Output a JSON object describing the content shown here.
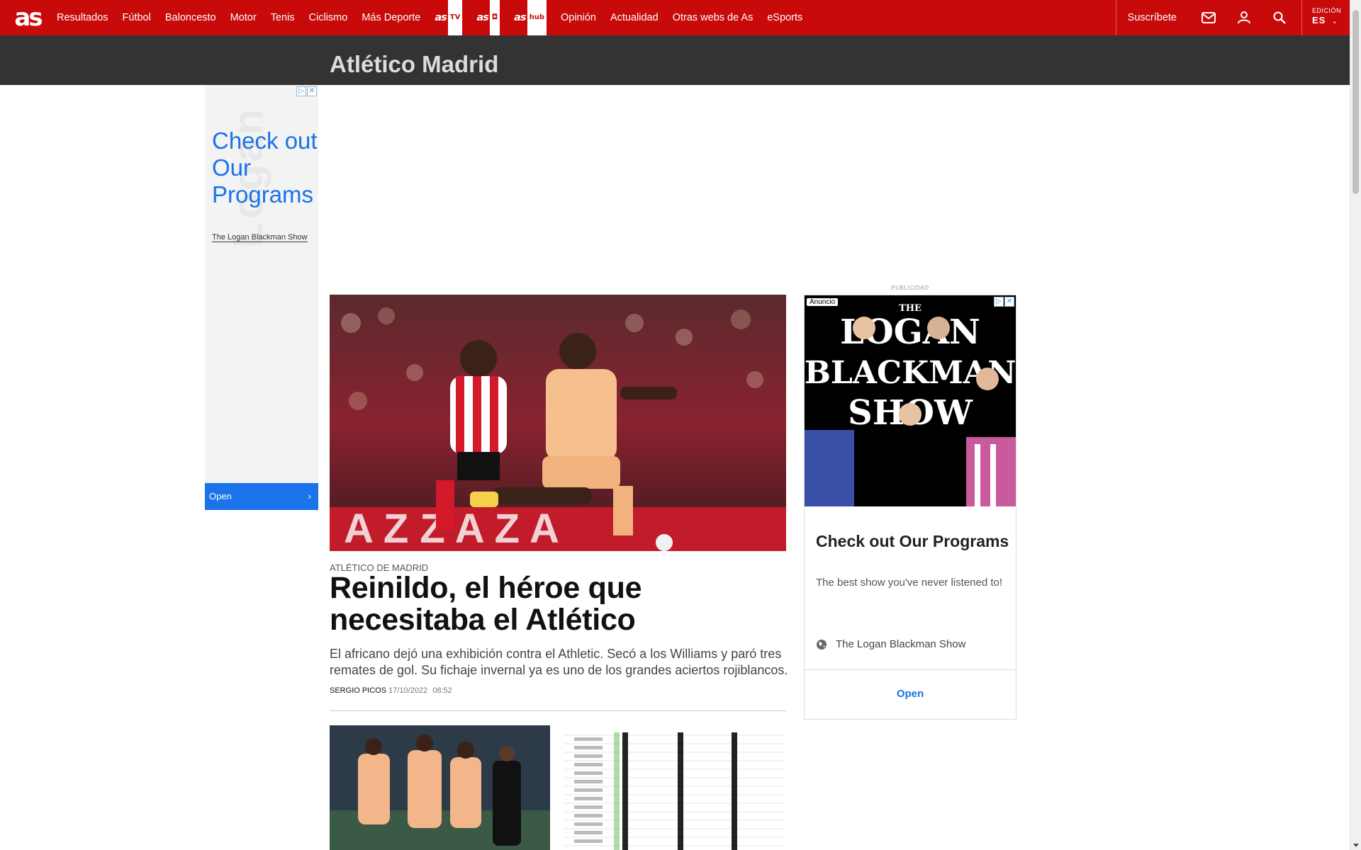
{
  "nav": {
    "logo": "as",
    "links": [
      "Resultados",
      "Fútbol",
      "Baloncesto",
      "Motor",
      "Tenis",
      "Ciclismo",
      "Más Deporte"
    ],
    "brands": [
      {
        "text": "as",
        "tag": "TV"
      },
      {
        "text": "as",
        "tag": "◘"
      },
      {
        "text": "as",
        "tag": "hub"
      }
    ],
    "links2": [
      "Opinión",
      "Actualidad",
      "Otras webs de As",
      "eSports"
    ],
    "subscribe": "Suscríbete",
    "edition_label": "EDICIÓN",
    "edition_value": "ES"
  },
  "section": {
    "title": "Atlético Madrid"
  },
  "left_ad": {
    "headline": "Check out Our Programs",
    "advertiser": "The Logan Blackman Show",
    "watermark": "Logan",
    "cta": "Open"
  },
  "article": {
    "kicker": "ATLÉTICO DE MADRID",
    "headline": "Reinildo, el héroe que necesitaba el Atlético",
    "summary": "El africano dejó una exhibición contra el Athletic. Secó a los Williams y paró tres remates de gol. Su fichaje invernal ya es uno de los grandes aciertos rojiblancos.",
    "author": "SERGIO PICOS",
    "date": "17/10/2022",
    "time": "08:52"
  },
  "right_ad": {
    "publicidad": "PUBLICIDAD",
    "badge": "Anuncio",
    "art_lines": [
      "THE",
      "LOGAN",
      "BLACKMAN",
      "SHOW"
    ],
    "title": "Check out Our Programs",
    "description": "The best show you've never listened to!",
    "advertiser": "The Logan Blackman Show",
    "cta": "Open"
  },
  "colors": {
    "brand_red": "#c80a0a",
    "section_bar": "#333333",
    "ad_blue": "#1a73e8"
  }
}
